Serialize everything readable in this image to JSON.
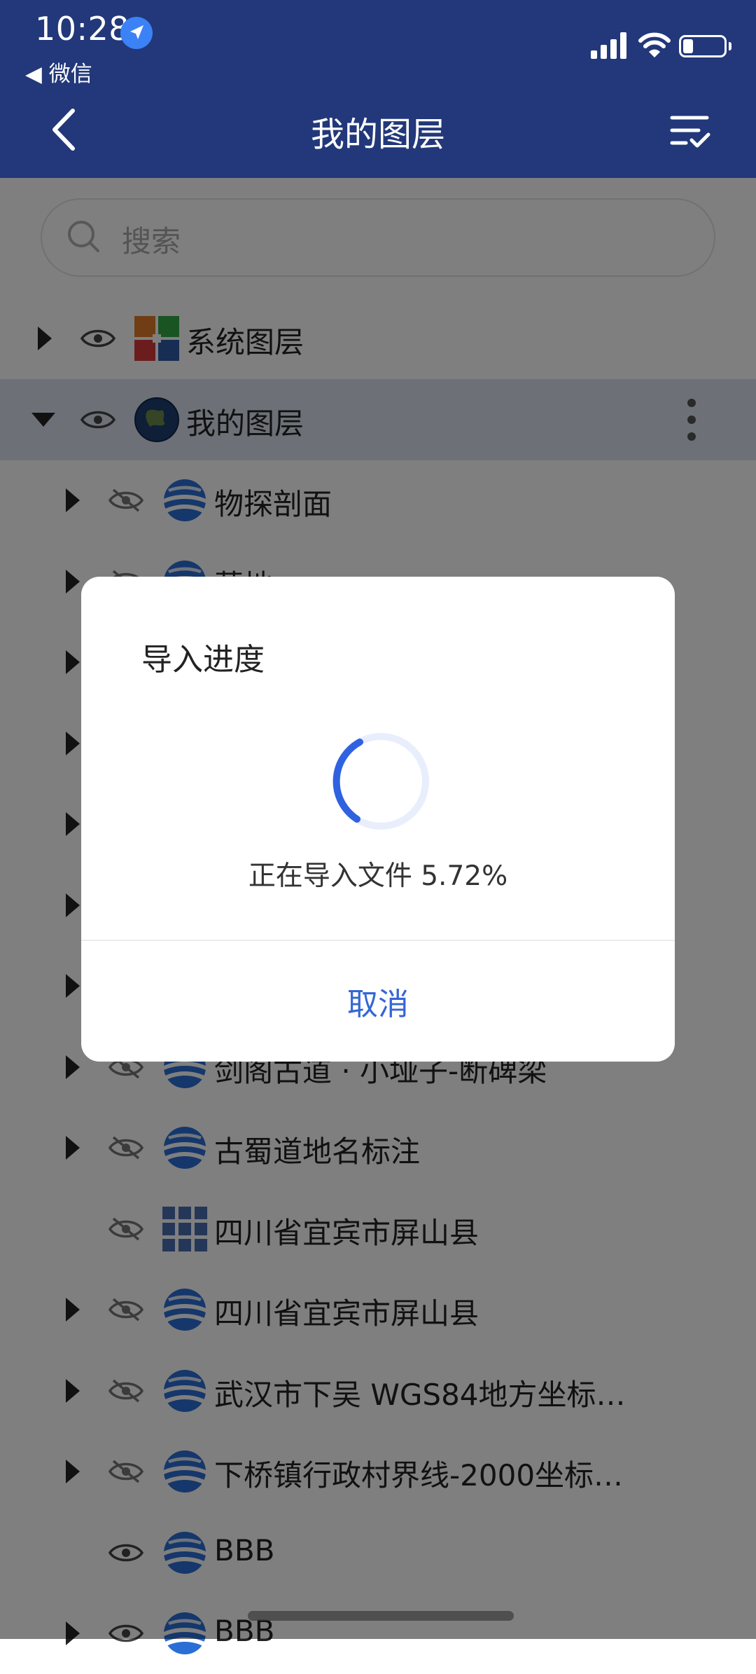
{
  "status_bar": {
    "time": "10:28",
    "back_app": "◀ 微信"
  },
  "header": {
    "title": "我的图层"
  },
  "search": {
    "placeholder": "搜索"
  },
  "layers": [
    {
      "label": "系统图层",
      "icon": "grid-color-icon",
      "visible": true,
      "arrow": "right"
    },
    {
      "label": "我的图层",
      "icon": "globe-icon",
      "visible": true,
      "arrow": "down",
      "selected": true
    },
    {
      "label": "物探剖面",
      "icon": "layer-globe-icon",
      "visible": false,
      "arrow": "right"
    },
    {
      "label": "墓地",
      "icon": "layer-globe-icon",
      "visible": false,
      "arrow": "right"
    },
    {
      "label": "",
      "icon": "layer-globe-icon",
      "visible": false,
      "arrow": "right"
    },
    {
      "label": "",
      "icon": "layer-globe-icon",
      "visible": false,
      "arrow": "right"
    },
    {
      "label": "",
      "icon": "layer-globe-icon",
      "visible": false,
      "arrow": "right"
    },
    {
      "label": "",
      "icon": "layer-globe-icon",
      "visible": false,
      "arrow": "right"
    },
    {
      "label": "",
      "icon": "layer-globe-icon",
      "visible": false,
      "arrow": "right"
    },
    {
      "label": "剑阁古道 · 小垭子-断碑梁",
      "icon": "layer-globe-icon",
      "visible": false,
      "arrow": "right"
    },
    {
      "label": "古蜀道地名标注",
      "icon": "layer-globe-icon",
      "visible": false,
      "arrow": "right"
    },
    {
      "label": "四川省宜宾市屏山县",
      "icon": "tile-grid-icon",
      "visible": false,
      "arrow": "none"
    },
    {
      "label": "四川省宜宾市屏山县",
      "icon": "layer-globe-icon",
      "visible": false,
      "arrow": "right"
    },
    {
      "label": "武汉市下吴 WGS84地方坐标…",
      "icon": "layer-globe-icon",
      "visible": false,
      "arrow": "right"
    },
    {
      "label": "下桥镇行政村界线-2000坐标…",
      "icon": "layer-globe-icon",
      "visible": false,
      "arrow": "right"
    },
    {
      "label": "BBB",
      "icon": "layer-globe-icon",
      "visible": true,
      "arrow": "none"
    },
    {
      "label": "BBB",
      "icon": "layer-globe-icon",
      "visible": true,
      "arrow": "right"
    }
  ],
  "dialog": {
    "title": "导入进度",
    "status": "正在导入文件 5.72%",
    "progress_percent": 5.72,
    "cancel_label": "取消"
  },
  "colors": {
    "header_bg": "#22387a",
    "accent": "#3566d6"
  }
}
